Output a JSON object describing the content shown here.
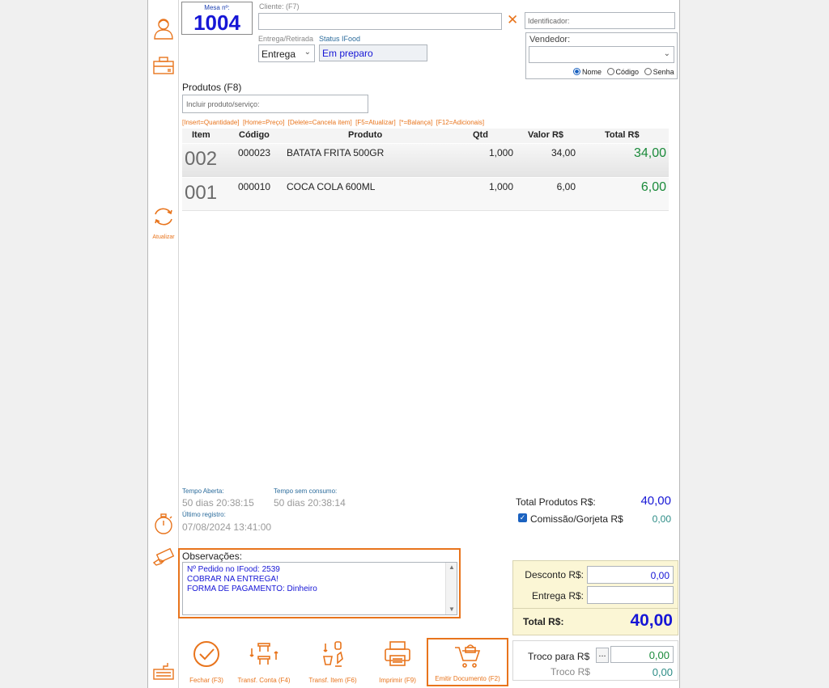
{
  "mesa": {
    "label": "Mesa nº:",
    "number": "1004"
  },
  "cliente": {
    "label": "Cliente: (F7)",
    "value": ""
  },
  "identificador": {
    "placeholder": "Identificador:"
  },
  "entrega_retirada": {
    "label": "Entrega/Retirada",
    "value": "Entrega"
  },
  "status_ifood": {
    "label": "Status IFood",
    "value": "Em preparo"
  },
  "vendedor": {
    "label": "Vendedor:",
    "value": "",
    "options": [
      "Nome",
      "Código",
      "Senha"
    ],
    "selected": "Nome"
  },
  "produtos": {
    "title": "Produtos (F8)",
    "placeholder": "Incluir produto/serviço:",
    "shortcuts": "[Insert=Quantidade]  [Home=Preço]  [Delete=Cancela item]  [F5=Atualizar]  [*=Balança]  [F12=Adicionais]"
  },
  "grid": {
    "headers": {
      "item": "Item",
      "codigo": "Código",
      "produto": "Produto",
      "qtd": "Qtd",
      "valor": "Valor R$",
      "total": "Total R$"
    },
    "rows": [
      {
        "item": "002",
        "codigo": "000023",
        "produto": "BATATA FRITA 500GR",
        "qtd": "1,000",
        "valor": "34,00",
        "total": "34,00"
      },
      {
        "item": "001",
        "codigo": "000010",
        "produto": "COCA COLA 600ML",
        "qtd": "1,000",
        "valor": "6,00",
        "total": "6,00"
      }
    ]
  },
  "sidebar": {
    "atualizar": "Atualizar"
  },
  "tempos": {
    "aberta_label": "Tempo Aberta:",
    "aberta_value": "50 dias 20:38:15",
    "sem_consumo_label": "Tempo sem consumo:",
    "sem_consumo_value": "50 dias 20:38:14",
    "ultimo_label": "Último registro:",
    "ultimo_value": "07/08/2024 13:41:00"
  },
  "totais": {
    "produtos_label": "Total Produtos R$:",
    "produtos_value": "40,00",
    "comissao_label": "Comissão/Gorjeta R$",
    "comissao_value": "0,00",
    "desconto_label": "Desconto R$:",
    "desconto_value": "0,00",
    "entrega_label": "Entrega R$:",
    "entrega_value": "",
    "total_label": "Total R$:",
    "total_value": "40,00",
    "troco_para_label": "Troco para R$",
    "troco_para_value": "0,00",
    "troco_para_btn": "...",
    "troco_label": "Troco R$",
    "troco_value": "0,00"
  },
  "observacoes": {
    "label": "Observações:",
    "lines": [
      "Nº Pedido no IFood: 2539",
      "COBRAR NA ENTREGA!",
      "FORMA DE PAGAMENTO: Dinheiro"
    ]
  },
  "buttons": {
    "fechar": "Fechar (F3)",
    "transf_conta": "Transf. Conta (F4)",
    "transf_item": "Transf. Item (F6)",
    "imprimir": "Imprimir (F9)",
    "emitir": "Emitir Documento (F2)"
  },
  "colors": {
    "accent": "#e8741c",
    "blue": "#1616d6",
    "green": "#1a8a3a",
    "teal": "#2c8c86"
  }
}
